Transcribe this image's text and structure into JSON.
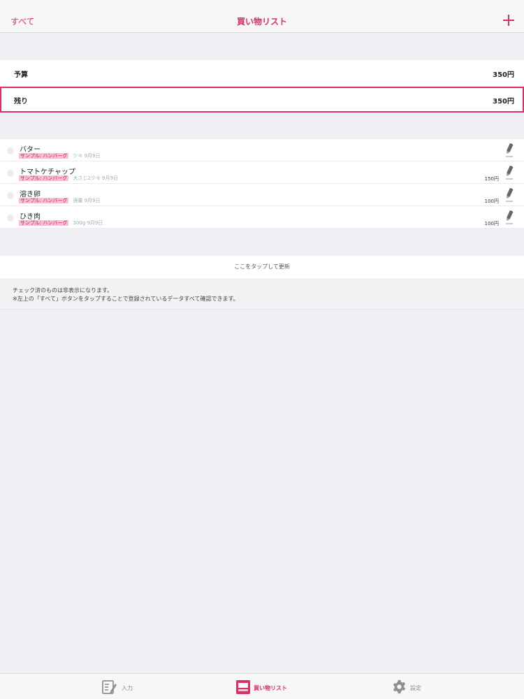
{
  "navbar": {
    "all_label": "すべて",
    "title": "買い物リスト",
    "add_icon": "plus-icon"
  },
  "budget": {
    "label": "予算",
    "value": "350円"
  },
  "remaining": {
    "label": "残り",
    "value": "350円"
  },
  "items": [
    {
      "name": "バター",
      "tag": "サンプル: ハンバーグ",
      "detail": "少々  9月9日",
      "price": ""
    },
    {
      "name": "トマトケチャップ",
      "tag": "サンプル: ハンバーグ",
      "detail": "大さじ2少々  9月9日",
      "price": "150円"
    },
    {
      "name": "溶き卵",
      "tag": "サンプル: ハンバーグ",
      "detail": "適量  9月9日",
      "price": "100円"
    },
    {
      "name": "ひき肉",
      "tag": "サンプル: ハンバーグ",
      "detail": "300g  9月9日",
      "price": "100円"
    }
  ],
  "refresh_label": "ここをタップして更新",
  "note": {
    "line1": "チェック済のものは非表示になります。",
    "line2": "※左上の「すべて」ボタンをタップすることで登録されているデータすべて確認できます。"
  },
  "tabbar": {
    "input_label": "入力",
    "list_label": "買い物リスト",
    "settings_label": "設定"
  },
  "colors": {
    "accent": "#d8306b",
    "tag_bg": "#f6bfd3",
    "background": "#efeff4"
  }
}
